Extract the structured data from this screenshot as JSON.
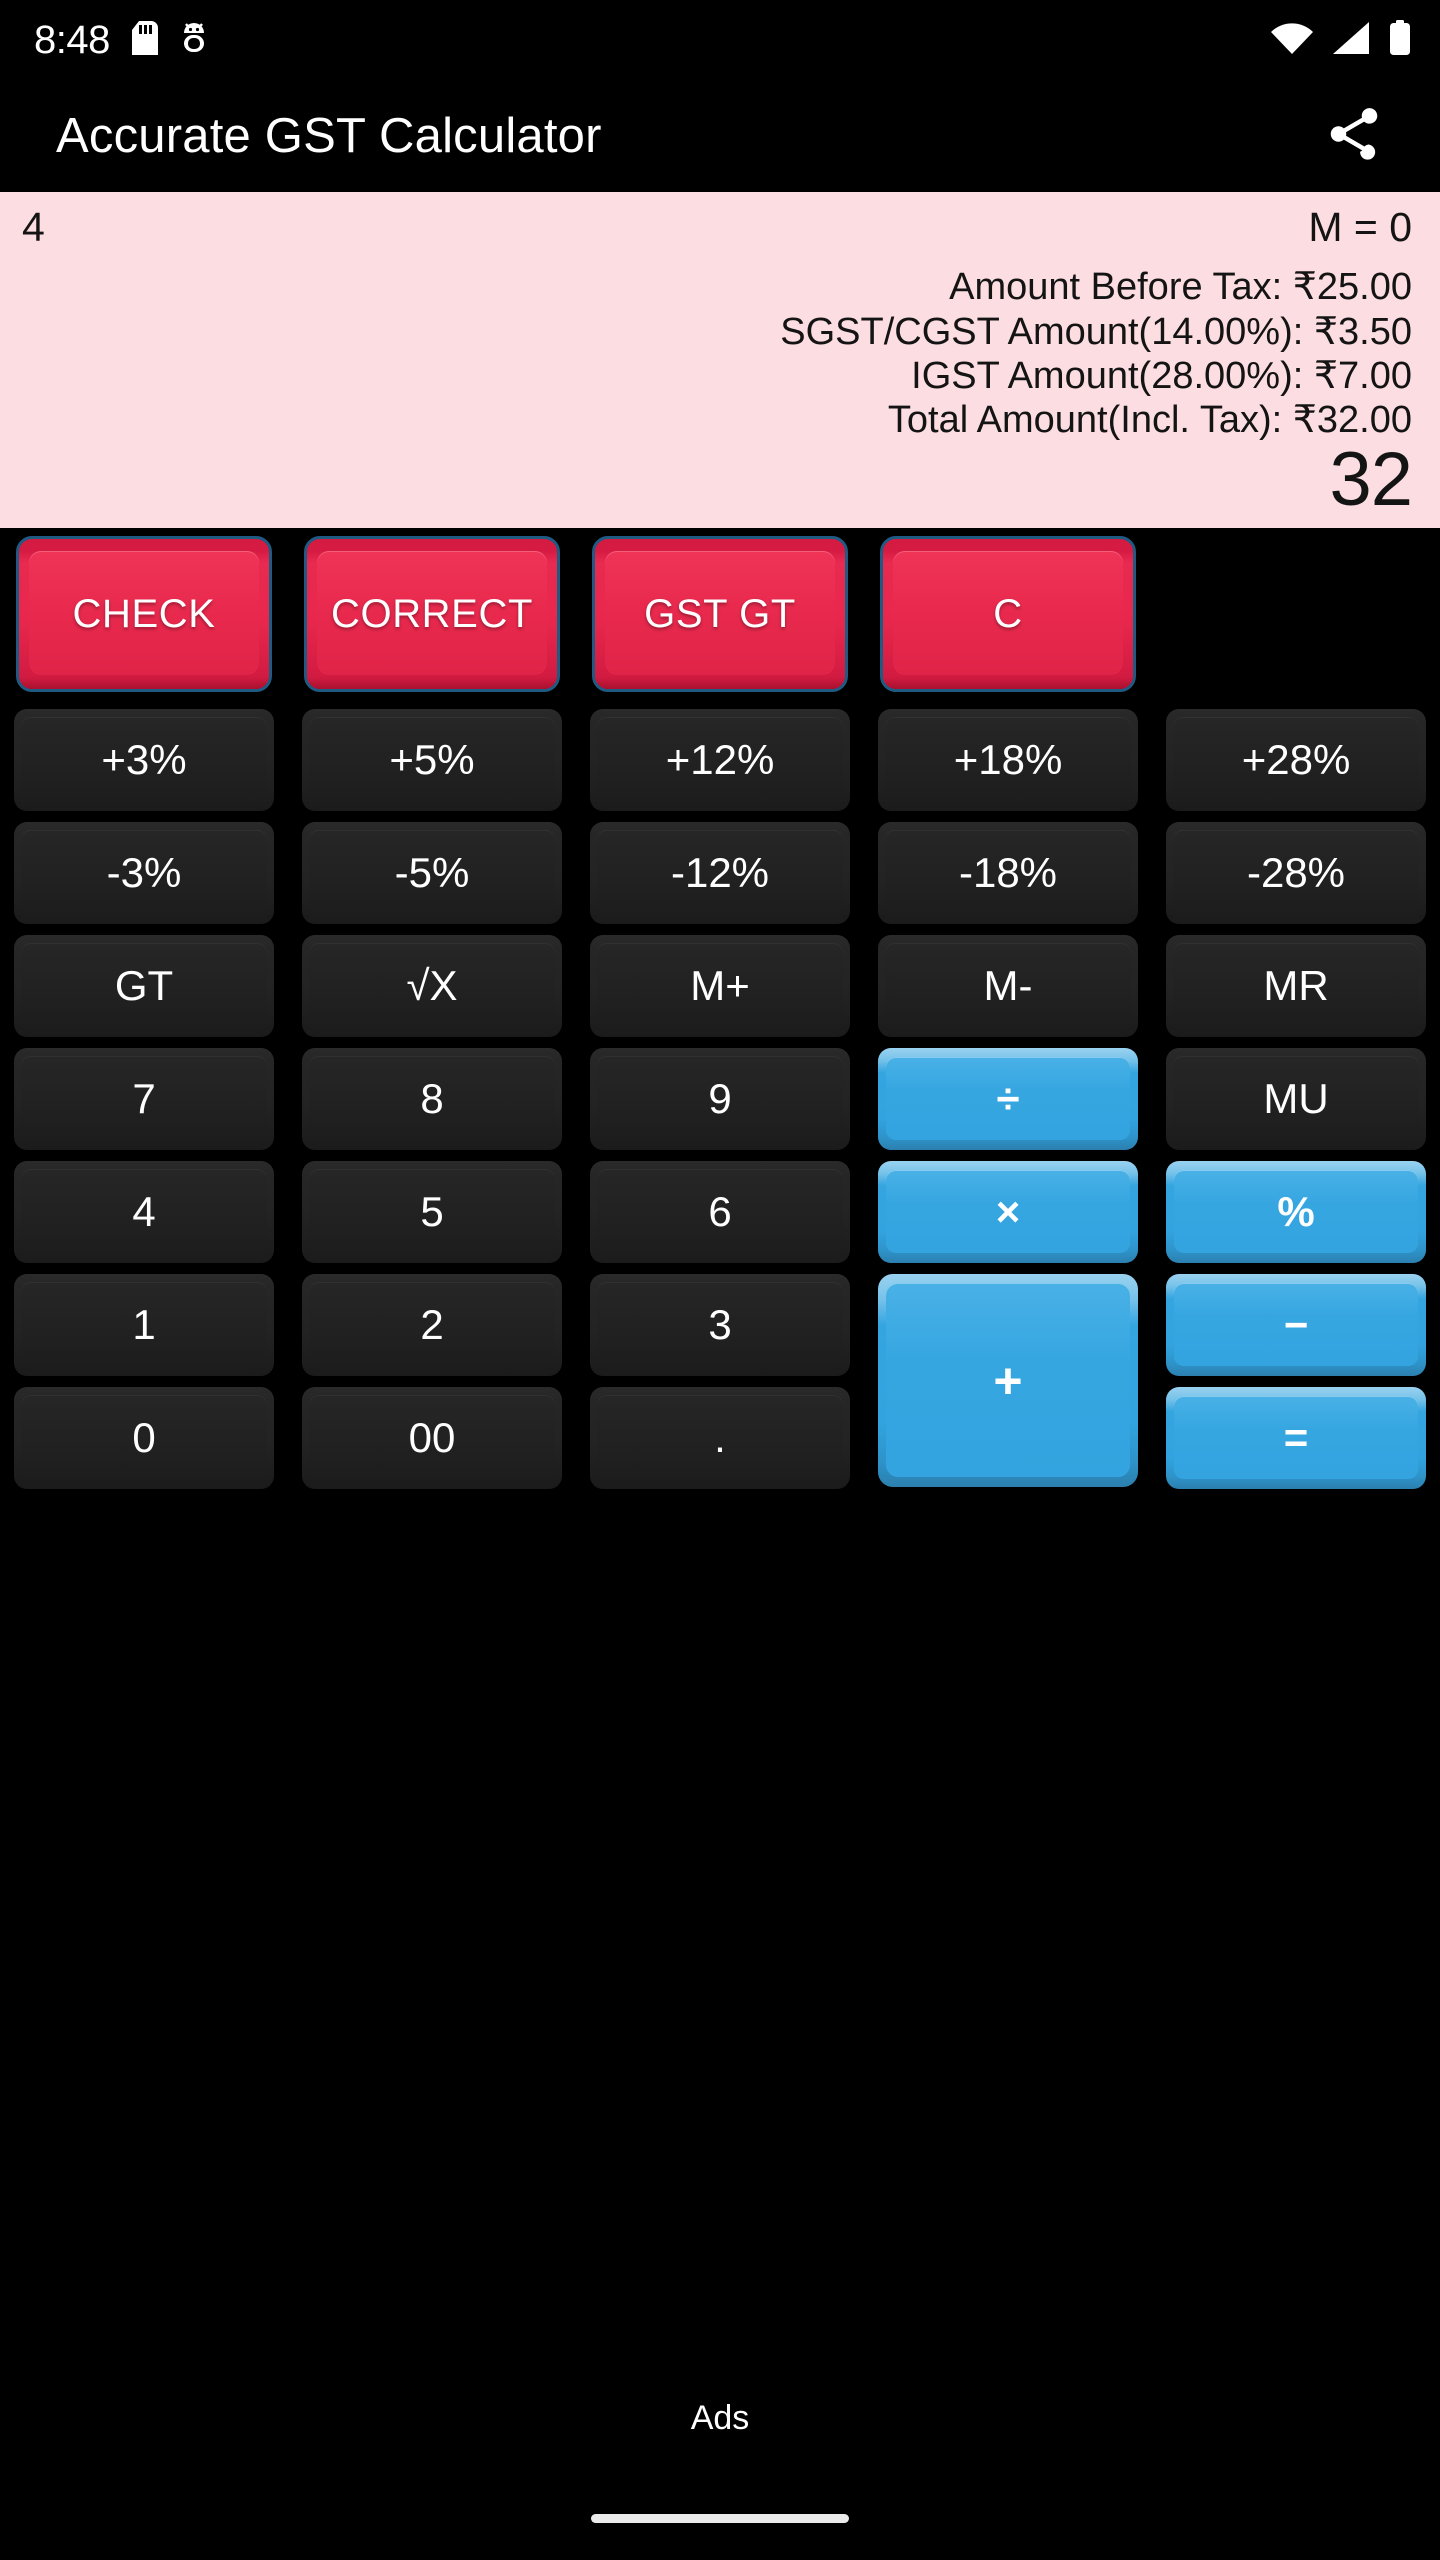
{
  "status_bar": {
    "time": "8:48",
    "icons_left": [
      "sd-card-icon",
      "android-debug-icon"
    ],
    "icons_right": [
      "wifi-icon",
      "cellular-signal-icon",
      "battery-icon"
    ]
  },
  "app_bar": {
    "title": "Accurate GST Calculator",
    "share_icon": "share-icon"
  },
  "display": {
    "background_color": "#FBDDE2",
    "expression": "4",
    "memory": "M = 0",
    "lines": [
      "Amount Before Tax: ₹25.00",
      "SGST/CGST Amount(14.00%): ₹3.50",
      "IGST Amount(28.00%): ₹7.00",
      "Total Amount(Incl. Tax): ₹32.00"
    ],
    "result": "32"
  },
  "colors": {
    "red_key": "#E62348",
    "blue_key": "#33A4DF",
    "dark_key": "#242424",
    "display_bg": "#FBDDE2",
    "background": "#000000"
  },
  "keypad": {
    "action_row": [
      {
        "label": "CHECK",
        "style": "red"
      },
      {
        "label": "CORRECT",
        "style": "red"
      },
      {
        "label": "GST GT",
        "style": "red"
      },
      {
        "label": "C",
        "style": "red"
      }
    ],
    "rows": [
      [
        {
          "label": "+3%",
          "style": "dark"
        },
        {
          "label": "+5%",
          "style": "dark"
        },
        {
          "label": "+12%",
          "style": "dark"
        },
        {
          "label": "+18%",
          "style": "dark"
        },
        {
          "label": "+28%",
          "style": "dark"
        }
      ],
      [
        {
          "label": "-3%",
          "style": "dark"
        },
        {
          "label": "-5%",
          "style": "dark"
        },
        {
          "label": "-12%",
          "style": "dark"
        },
        {
          "label": "-18%",
          "style": "dark"
        },
        {
          "label": "-28%",
          "style": "dark"
        }
      ],
      [
        {
          "label": "GT",
          "style": "dark"
        },
        {
          "label": "√X",
          "style": "dark"
        },
        {
          "label": "M+",
          "style": "dark"
        },
        {
          "label": "M-",
          "style": "dark"
        },
        {
          "label": "MR",
          "style": "dark"
        }
      ],
      [
        {
          "label": "7",
          "style": "dark"
        },
        {
          "label": "8",
          "style": "dark"
        },
        {
          "label": "9",
          "style": "dark"
        },
        {
          "label": "÷",
          "style": "blue"
        },
        {
          "label": "MU",
          "style": "dark"
        }
      ],
      [
        {
          "label": "4",
          "style": "dark"
        },
        {
          "label": "5",
          "style": "dark"
        },
        {
          "label": "6",
          "style": "dark"
        },
        {
          "label": "×",
          "style": "blue"
        },
        {
          "label": "%",
          "style": "blue"
        }
      ]
    ],
    "bottom_left_rows": [
      [
        {
          "label": "1",
          "style": "dark"
        },
        {
          "label": "2",
          "style": "dark"
        },
        {
          "label": "3",
          "style": "dark"
        }
      ],
      [
        {
          "label": "0",
          "style": "dark"
        },
        {
          "label": "00",
          "style": "dark"
        },
        {
          "label": ".",
          "style": "dark"
        }
      ]
    ],
    "plus_key": {
      "label": "+",
      "style": "blue"
    },
    "right_col": [
      {
        "label": "−",
        "style": "blue"
      },
      {
        "label": "=",
        "style": "blue"
      }
    ]
  },
  "ads": {
    "label": "Ads"
  },
  "nav_bar": {
    "handle": "gesture-nav-handle"
  }
}
